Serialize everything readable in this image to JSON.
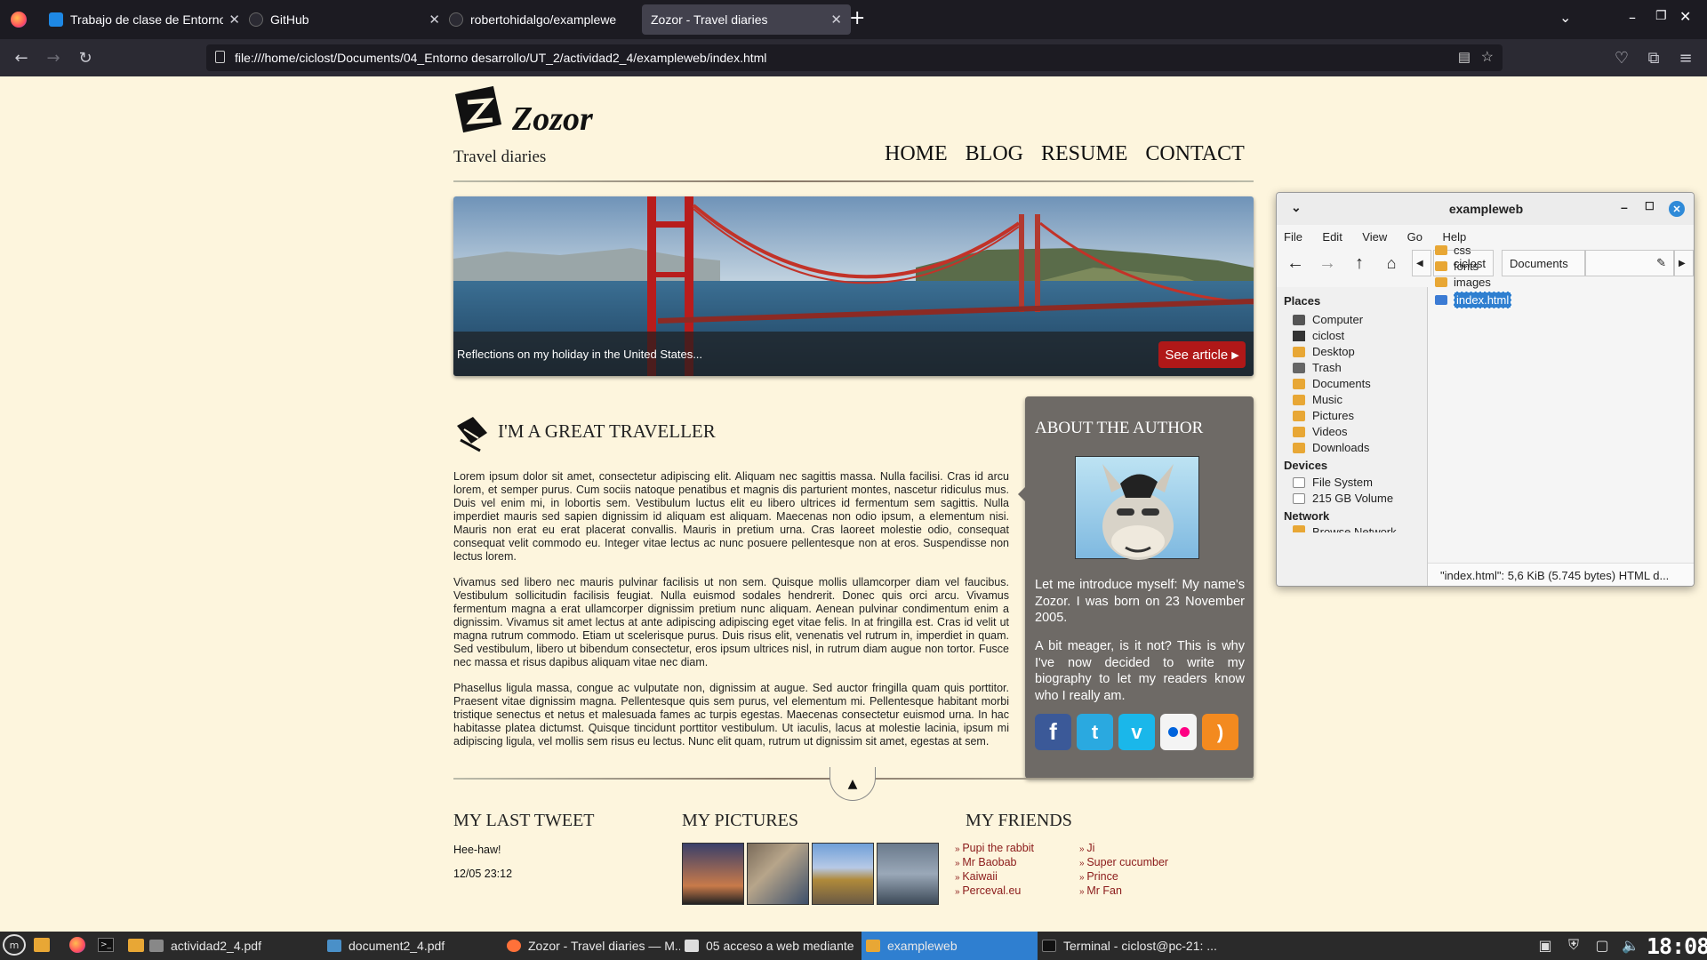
{
  "browser": {
    "tabs": [
      {
        "title": "Trabajo de clase de Entorno",
        "active": false,
        "favicon": "classroom-icon"
      },
      {
        "title": "GitHub",
        "active": false,
        "favicon": "github-icon"
      },
      {
        "title": "robertohidalgo/examplewe",
        "active": false,
        "favicon": "github-icon"
      },
      {
        "title": "Zozor - Travel diaries",
        "active": true,
        "favicon": "zozor-icon"
      }
    ],
    "new_tab_label": "+",
    "url": "file:///home/ciclost/Documents/04_Entorno desarrollo/UT_2/actividad2_4/exampleweb/index.html"
  },
  "site": {
    "brand": "Zozor",
    "tagline": "Travel diaries",
    "nav": [
      "HOME",
      "BLOG",
      "RESUME",
      "CONTACT"
    ],
    "banner": {
      "caption": "Reflections on my holiday in the United States...",
      "button": "See article"
    },
    "article": {
      "title": "I'M A GREAT TRAVELLER",
      "paragraphs": [
        "Lorem ipsum dolor sit amet, consectetur adipiscing elit. Aliquam nec sagittis massa. Nulla facilisi. Cras id arcu lorem, et semper purus. Cum sociis natoque penatibus et magnis dis parturient montes, nascetur ridiculus mus. Duis vel enim mi, in lobortis sem. Vestibulum luctus elit eu libero ultrices id fermentum sem sagittis. Nulla imperdiet mauris sed sapien dignissim id aliquam est aliquam. Maecenas non odio ipsum, a elementum nisi. Mauris non erat eu erat placerat convallis. Mauris in pretium urna. Cras laoreet molestie odio, consequat consequat velit commodo eu. Integer vitae lectus ac nunc posuere pellentesque non at eros. Suspendisse non lectus lorem.",
        "Vivamus sed libero nec mauris pulvinar facilisis ut non sem. Quisque mollis ullamcorper diam vel faucibus. Vestibulum sollicitudin facilisis feugiat. Nulla euismod sodales hendrerit. Donec quis orci arcu. Vivamus fermentum magna a erat ullamcorper dignissim pretium nunc aliquam. Aenean pulvinar condimentum enim a dignissim. Vivamus sit amet lectus at ante adipiscing adipiscing eget vitae felis. In at fringilla est. Cras id velit ut magna rutrum commodo. Etiam ut scelerisque purus. Duis risus elit, venenatis vel rutrum in, imperdiet in quam. Sed vestibulum, libero ut bibendum consectetur, eros ipsum ultrices nisl, in rutrum diam augue non tortor. Fusce nec massa et risus dapibus aliquam vitae nec diam.",
        "Phasellus ligula massa, congue ac vulputate non, dignissim at augue. Sed auctor fringilla quam quis porttitor. Praesent vitae dignissim magna. Pellentesque quis sem purus, vel elementum mi. Pellentesque habitant morbi tristique senectus et netus et malesuada fames ac turpis egestas. Maecenas consectetur euismod urna. In hac habitasse platea dictumst. Quisque tincidunt porttitor vestibulum. Ut iaculis, lacus at molestie lacinia, ipsum mi adipiscing ligula, vel mollis sem risus eu lectus. Nunc elit quam, rutrum ut dignissim sit amet, egestas at sem."
      ]
    },
    "about": {
      "title": "ABOUT THE AUTHOR",
      "p1": "Let me introduce myself: My name's Zozor. I was born on 23 November 2005.",
      "p2": "A bit meager, is it not? This is why I've now decided to write my biography to let my readers know who I really am.",
      "social": [
        {
          "name": "facebook-icon",
          "glyph": "f",
          "color": "#3b5998"
        },
        {
          "name": "twitter-icon",
          "glyph": "t",
          "color": "#2aa9e0"
        },
        {
          "name": "vimeo-icon",
          "glyph": "v",
          "color": "#1ab7ea"
        },
        {
          "name": "flickr-icon",
          "glyph": "●●",
          "color": "#f4f4f4"
        },
        {
          "name": "rss-icon",
          "glyph": ")",
          "color": "#f38a1f"
        }
      ]
    },
    "footer": {
      "tweet_title": "MY LAST TWEET",
      "tweet_text": "Hee-haw!",
      "tweet_date": "12/05 23:12",
      "pictures_title": "MY PICTURES",
      "friends_title": "MY FRIENDS",
      "friends_col1": [
        "Pupi the rabbit",
        "Mr Baobab",
        "Kaiwaii",
        "Perceval.eu"
      ],
      "friends_col2": [
        "Ji",
        "Super cucumber",
        "Prince",
        "Mr Fan"
      ]
    }
  },
  "file_manager": {
    "title": "exampleweb",
    "menu": [
      "File",
      "Edit",
      "View",
      "Go",
      "Help"
    ],
    "breadcrumbs": [
      "ciclost",
      "Documents"
    ],
    "places_header": "Places",
    "places": [
      "Computer",
      "ciclost",
      "Desktop",
      "Trash",
      "Documents",
      "Music",
      "Pictures",
      "Videos",
      "Downloads"
    ],
    "devices_header": "Devices",
    "devices": [
      "File System",
      "215 GB Volume"
    ],
    "network_header": "Network",
    "network": [
      "Browse Network"
    ],
    "files": [
      "css",
      "fonts",
      "images",
      "index.html"
    ],
    "selected_file": "index.html",
    "status": "\"index.html\": 5,6 KiB (5.745 bytes) HTML d..."
  },
  "taskbar": {
    "items": [
      {
        "label": "actividad2_4.pdf",
        "active": false
      },
      {
        "label": "document2_4.pdf",
        "active": false
      },
      {
        "label": "Zozor - Travel diaries — M...",
        "active": false
      },
      {
        "label": "05 acceso a web mediante ...",
        "active": false
      },
      {
        "label": "exampleweb",
        "active": true
      },
      {
        "label": "Terminal - ciclost@pc-21: ...",
        "active": false
      }
    ],
    "clock": "18:08"
  }
}
